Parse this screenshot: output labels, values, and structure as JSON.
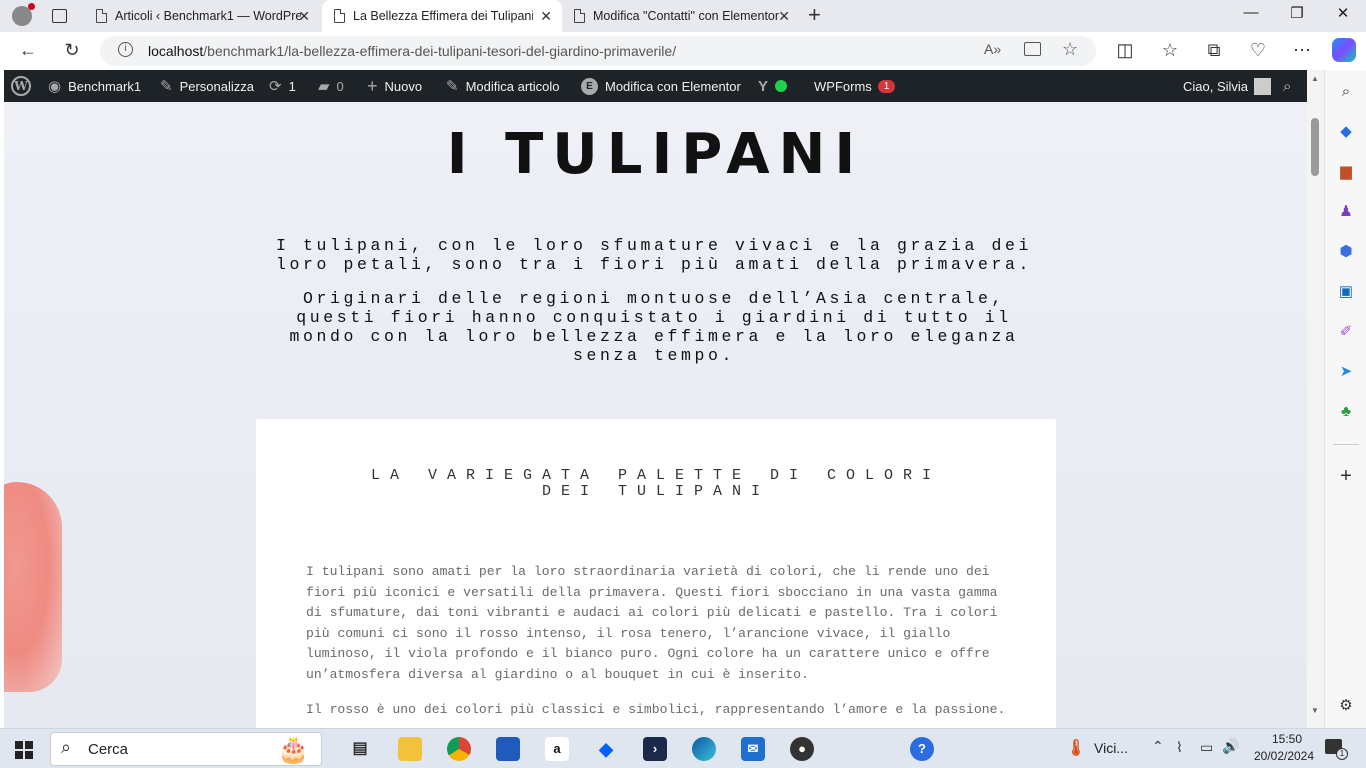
{
  "browser": {
    "tabs": [
      {
        "label": "Articoli ‹ Benchmark1 — WordPress",
        "active": false
      },
      {
        "label": "La Bellezza Effimera dei Tulipani",
        "active": true
      },
      {
        "label": "Modifica \"Contatti\" con Elementor",
        "active": false
      }
    ],
    "url_host": "localhost",
    "url_path": "/benchmark1/la-bellezza-effimera-dei-tulipani-tesori-del-giardino-primaverile/"
  },
  "wpbar": {
    "site": "Benchmark1",
    "customize": "Personalizza",
    "updates_count": "1",
    "comments_count": "0",
    "new": "Nuovo",
    "edit_post": "Modifica articolo",
    "edit_elementor": "Modifica con Elementor",
    "wpforms": "WPForms",
    "wpforms_badge": "1",
    "greeting": "Ciao, Silvia"
  },
  "content": {
    "hero_title": "I TULIPANI",
    "hero_p1": "I tulipani, con le loro sfumature vivaci e la grazia dei loro petali, sono tra i fiori più amati della primavera.",
    "hero_p2": "Originari delle regioni montuose dell’Asia centrale, questi fiori hanno conquistato i giardini di tutto il mondo con la loro bellezza effimera e la loro eleganza senza tempo.",
    "card_title": "LA VARIEGATA PALETTE DI COLORI DEI TULIPANI",
    "card_p1": "I tulipani sono amati per la loro straordinaria varietà di colori, che li rende uno dei fiori più iconici e versatili della primavera. Questi fiori sbocciano in una vasta gamma di sfumature, dai toni vibranti e audaci ai colori più delicati e pastello. Tra i colori più comuni ci sono il rosso intenso, il rosa tenero, l’arancione vivace, il giallo luminoso, il viola profondo e il bianco puro. Ogni colore ha un carattere unico e offre un’atmosfera diversa al giardino o al bouquet in cui è inserito.",
    "card_p2": "Il rosso è uno dei colori più classici e simbolici, rappresentando l’amore e la passione."
  },
  "taskbar": {
    "search_label": "Cerca",
    "weather": "Vici...",
    "time": "15:50",
    "date": "20/02/2024",
    "notif": "1"
  },
  "colors": {
    "wpbar_bg": "#1d2327",
    "badge": "#d63638",
    "page_bg": "#eaedf4"
  }
}
